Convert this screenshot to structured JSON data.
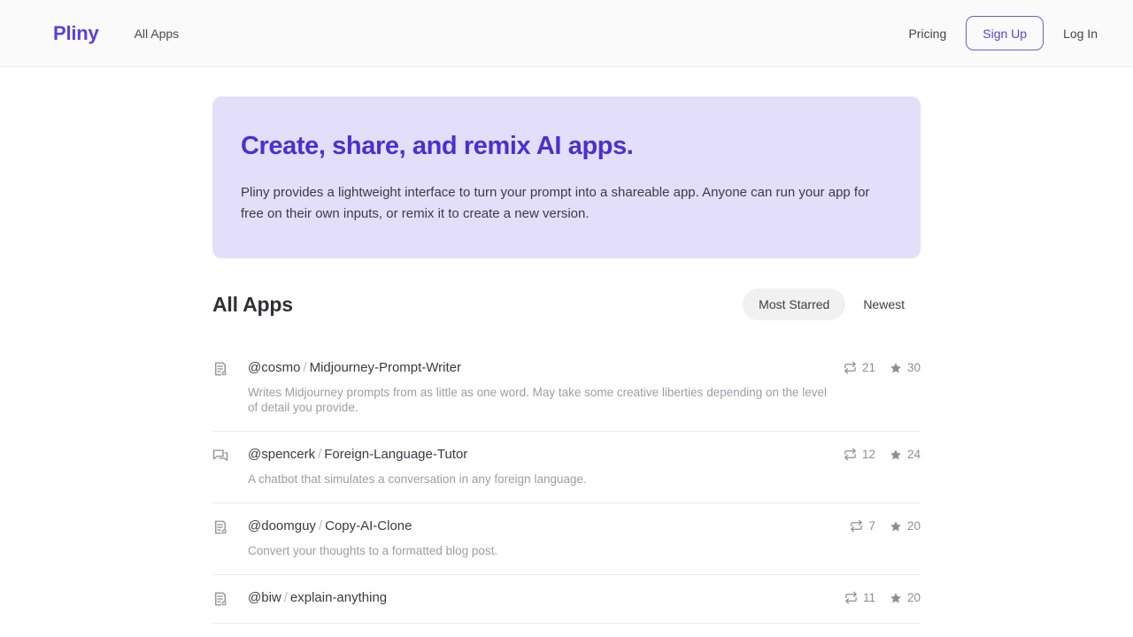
{
  "header": {
    "brand": "Pliny",
    "nav_left": [
      {
        "label": "All Apps",
        "name": "nav-all-apps"
      }
    ],
    "pricing_label": "Pricing",
    "signup_label": "Sign Up",
    "login_label": "Log In",
    "accent_color": "#5b3fdb",
    "background": "#fafafa"
  },
  "hero": {
    "title": "Create, share, and remix AI apps.",
    "subtitle": "Pliny provides a lightweight interface to turn your prompt into a shareable app. Anyone can run your app for free on their own inputs, or remix it to create a new version.",
    "background": "#e3dffb",
    "title_color": "#4a2fd4"
  },
  "section": {
    "title": "All Apps",
    "sorts": [
      {
        "label": "Most Starred",
        "active": true
      },
      {
        "label": "Newest",
        "active": false
      }
    ]
  },
  "apps": [
    {
      "icon": "document-plus-icon",
      "author": "@cosmo",
      "separator": "/",
      "name": "Midjourney-Prompt-Writer",
      "description": "Writes Midjourney prompts from as little as one word. May take some creative liberties depending on the level of detail you provide.",
      "remixes": "21",
      "stars": "30"
    },
    {
      "icon": "chat-bubbles-icon",
      "author": "@spencerk",
      "separator": "/",
      "name": "Foreign-Language-Tutor",
      "description": "A chatbot that simulates a conversation in any foreign language.",
      "remixes": "12",
      "stars": "24"
    },
    {
      "icon": "document-plus-icon",
      "author": "@doomguy",
      "separator": "/",
      "name": "Copy-AI-Clone",
      "description": "Convert your thoughts to a formatted blog post.",
      "remixes": "7",
      "stars": "20"
    },
    {
      "icon": "document-plus-icon",
      "author": "@biw",
      "separator": "/",
      "name": "explain-anything",
      "description": "",
      "remixes": "11",
      "stars": "20"
    }
  ],
  "icons": {
    "remix": "remix-icon",
    "star": "star-icon"
  }
}
